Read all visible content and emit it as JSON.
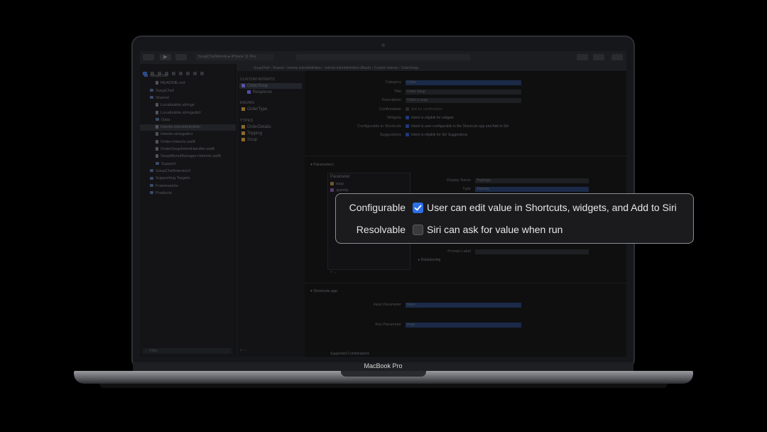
{
  "device": {
    "brand_label": "MacBook Pro"
  },
  "toolbar": {
    "scheme": "SoupChefIntents",
    "destination": "iPhone 11 Pro"
  },
  "breadcrumb": [
    "SoupChef",
    "Shared",
    "Intents.intentdefinition",
    "Intents.intentdefinition (Base)",
    "Custom Intents",
    "OrderSoup"
  ],
  "navigator": {
    "items": [
      {
        "label": "SoupChef",
        "indent": 0,
        "kind": "project"
      },
      {
        "label": "README.md",
        "indent": 2,
        "kind": "file"
      },
      {
        "label": "SoupChef",
        "indent": 1,
        "kind": "folder"
      },
      {
        "label": "Shared",
        "indent": 1,
        "kind": "folder"
      },
      {
        "label": "Localizable.strings",
        "indent": 2,
        "kind": "file"
      },
      {
        "label": "Localizable.stringsdict",
        "indent": 2,
        "kind": "file"
      },
      {
        "label": "Data",
        "indent": 2,
        "kind": "folder"
      },
      {
        "label": "Intents.intentdefinition",
        "indent": 2,
        "kind": "file"
      },
      {
        "label": "Intents.stringsdict",
        "indent": 2,
        "kind": "file"
      },
      {
        "label": "Order+Intents.swift",
        "indent": 2,
        "kind": "file"
      },
      {
        "label": "OrderSoupIntentHandler.swift",
        "indent": 2,
        "kind": "file"
      },
      {
        "label": "SoupMenuManager+Intents.swift",
        "indent": 2,
        "kind": "file"
      },
      {
        "label": "Support",
        "indent": 2,
        "kind": "folder"
      },
      {
        "label": "SoupChefIntentsUI",
        "indent": 1,
        "kind": "folder"
      },
      {
        "label": "Supporting Targets",
        "indent": 1,
        "kind": "folder"
      },
      {
        "label": "Frameworks",
        "indent": 1,
        "kind": "folder"
      },
      {
        "label": "Products",
        "indent": 1,
        "kind": "folder"
      }
    ],
    "filter_placeholder": "Filter"
  },
  "intents_list": {
    "custom_header": "CUSTOM INTENTS",
    "custom": [
      "OrderSoup",
      "Response"
    ],
    "enums_header": "ENUMS",
    "enums": [
      "OrderType"
    ],
    "types_header": "TYPES",
    "types": [
      "OrderDetails",
      "Topping",
      "Soup"
    ]
  },
  "editor": {
    "rows": [
      {
        "label": "Category",
        "value": "Order"
      },
      {
        "label": "Title",
        "value": "Order Soup"
      },
      {
        "label": "Description",
        "value": "Order a soup"
      },
      {
        "label": "Confirmation",
        "value": "Ask for confirmation"
      },
      {
        "label": "Widgets",
        "value": "Intent is eligible for widgets"
      },
      {
        "label": "Configurable in Shortcuts",
        "value": "Intent is user-configurable in the Shortcuts app and Add to Siri"
      },
      {
        "label": "Suggestions",
        "value": "Intent is eligible for Siri Suggestions"
      }
    ],
    "parameters_header": "Parameters",
    "param_column": "Parameter",
    "params": [
      "soup",
      "quantity",
      "options",
      "orderType"
    ],
    "display_name_label": "Display Name",
    "display_name_value": "Toppings",
    "type_label": "Type",
    "type_value": "Topping",
    "prompt_label": "Prompt Label",
    "relationship_label": "Relationship",
    "shortcuts_header": "Shortcuts app",
    "input_parameter_label": "Input Parameter",
    "input_parameter_value": "None",
    "key_parameter_label": "Key Parameter",
    "key_parameter_value": "soup",
    "supported_combinations": "Supported Combinations"
  },
  "popup": {
    "configurable_label": "Configurable",
    "configurable_checked": true,
    "configurable_text": "User can edit value in Shortcuts, widgets, and Add to Siri",
    "resolvable_label": "Resolvable",
    "resolvable_checked": false,
    "resolvable_text": "Siri can ask for value when run"
  }
}
